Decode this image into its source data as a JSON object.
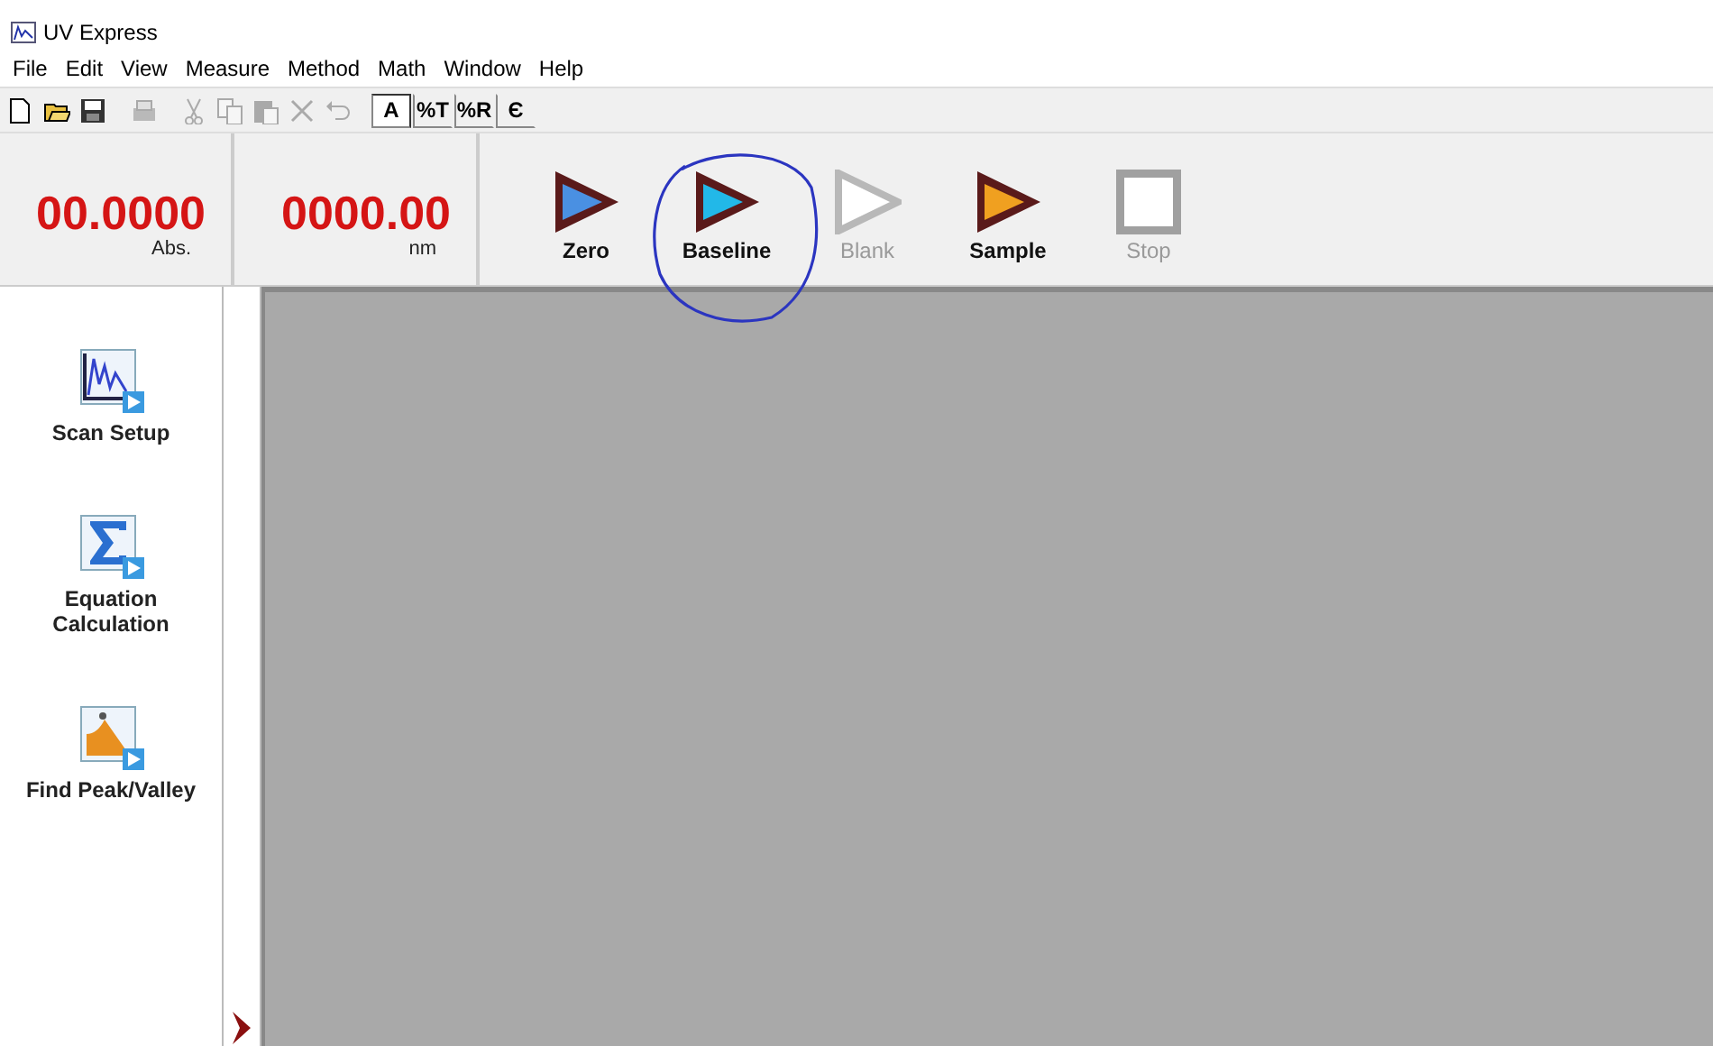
{
  "window": {
    "title": "UV Express"
  },
  "menu": [
    "File",
    "Edit",
    "View",
    "Measure",
    "Method",
    "Math",
    "Window",
    "Help"
  ],
  "toolbar": [
    {
      "kind": "new",
      "disabled": false,
      "pressed": false
    },
    {
      "kind": "open",
      "disabled": false,
      "pressed": false
    },
    {
      "kind": "save",
      "disabled": false,
      "pressed": false
    },
    {
      "kind": "sep"
    },
    {
      "kind": "print",
      "disabled": true,
      "pressed": false
    },
    {
      "kind": "sep"
    },
    {
      "kind": "cut",
      "disabled": true,
      "pressed": false
    },
    {
      "kind": "copy",
      "disabled": true,
      "pressed": false
    },
    {
      "kind": "paste",
      "disabled": true,
      "pressed": false
    },
    {
      "kind": "delete",
      "disabled": true,
      "pressed": false
    },
    {
      "kind": "undo",
      "disabled": true,
      "pressed": false
    },
    {
      "kind": "sep"
    },
    {
      "kind": "text",
      "label": "A",
      "disabled": false,
      "pressed": true
    },
    {
      "kind": "text",
      "label": "%T",
      "disabled": false,
      "pressed": false
    },
    {
      "kind": "text",
      "label": "%R",
      "disabled": false,
      "pressed": false
    },
    {
      "kind": "text",
      "label": "Є",
      "disabled": false,
      "pressed": false
    }
  ],
  "readouts": [
    {
      "value": "00.0000",
      "unit": "Abs."
    },
    {
      "value": "0000.00",
      "unit": "nm"
    }
  ],
  "actions": [
    {
      "label": "Zero",
      "kind": "play",
      "color": "#4a90e2",
      "disabled": false,
      "circled": false
    },
    {
      "label": "Baseline",
      "kind": "play",
      "color": "#22b8e8",
      "disabled": false,
      "circled": true
    },
    {
      "label": "Blank",
      "kind": "play",
      "color": "#b8b8b8",
      "disabled": true,
      "circled": false
    },
    {
      "label": "Sample",
      "kind": "play",
      "color": "#f0a020",
      "disabled": false,
      "circled": false
    },
    {
      "label": "Stop",
      "kind": "stop",
      "color": "#a0a0a0",
      "disabled": true,
      "circled": false
    }
  ],
  "sidebar": {
    "items": [
      {
        "label": "Scan Setup",
        "kind": "scan"
      },
      {
        "label": "Equation Calculation",
        "kind": "equation"
      },
      {
        "label": "Find Peak/Valley",
        "kind": "peak"
      }
    ]
  }
}
